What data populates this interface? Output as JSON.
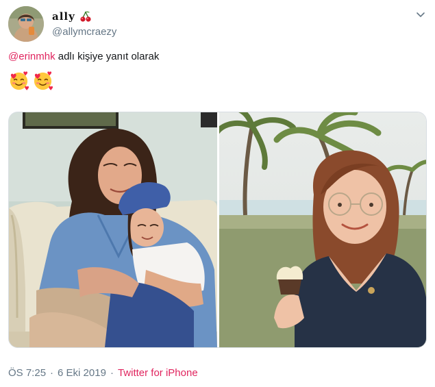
{
  "author": {
    "display_name": "ally",
    "handle": "@allymcraezy",
    "avatar_icon": "profile-photo",
    "name_emoji": "cherries-icon"
  },
  "reply": {
    "mention": "@erinmhk",
    "text": "adlı kişiye yanıt olarak"
  },
  "tweet": {
    "emojis": [
      "smiling-face-with-hearts-icon",
      "smiling-face-with-hearts-icon"
    ]
  },
  "media": {
    "left_photo": "childhood-photo-mother-and-daughter",
    "right_photo": "adult-woman-holding-cupcake-beach"
  },
  "meta": {
    "time": "ÖS 7:25",
    "separator": "·",
    "date": "6 Eki 2019",
    "source_separator": "·",
    "source": "Twitter for iPhone"
  },
  "colors": {
    "accent": "#e0245e",
    "secondary_text": "#657786",
    "border": "#d7dde2"
  }
}
